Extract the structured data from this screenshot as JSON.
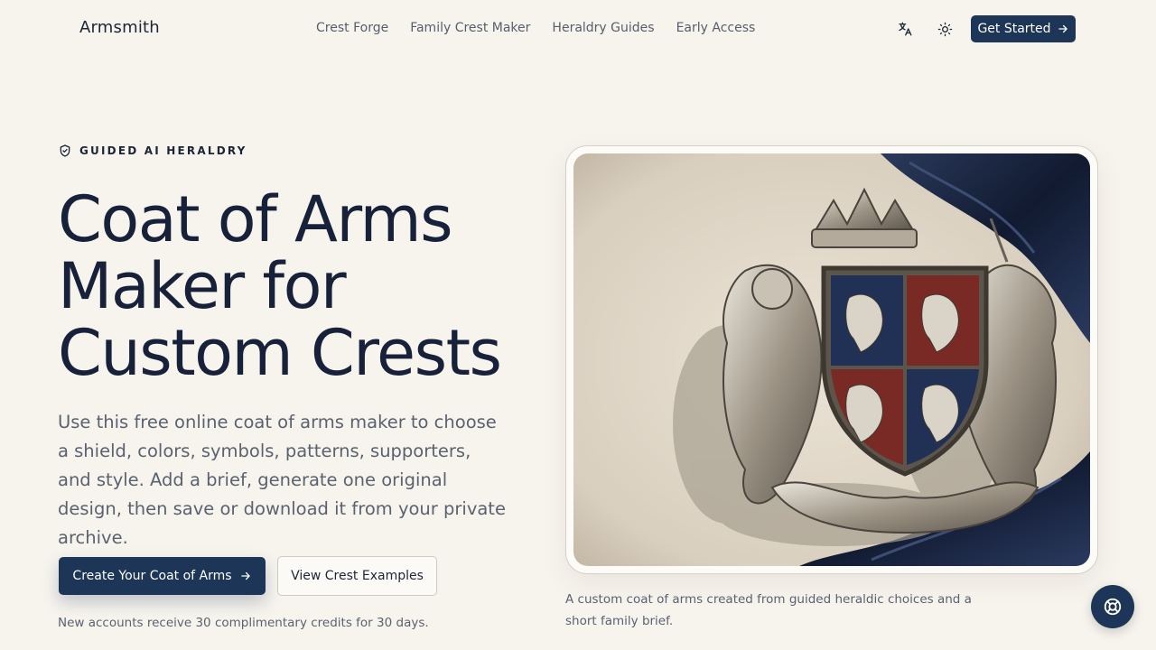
{
  "header": {
    "logo": "Armsmith",
    "nav": [
      "Crest Forge",
      "Family Crest Maker",
      "Heraldry Guides",
      "Early Access"
    ],
    "cta": "Get Started",
    "icons": {
      "translate": "translate-icon",
      "theme": "sun-icon"
    }
  },
  "hero": {
    "eyebrow": "GUIDED AI HERALDRY",
    "title_line1": "Coat of Arms",
    "title_line2": "Maker for",
    "title_line3": "Custom Crests",
    "description": "Use this free online coat of arms maker to choose a shield, colors, symbols, patterns, supporters, and style. Add a brief, generate one original design, then save or download it from your private archive.",
    "primary_cta": "Create Your Coat of Arms",
    "secondary_cta": "View Crest Examples",
    "credits_note": "New accounts receive 30 complimentary credits for 30 days."
  },
  "showcase": {
    "caption": "A custom coat of arms created from guided heraldic choices and a short family brief."
  },
  "colors": {
    "background": "#f7f4ee",
    "primary": "#1d3557",
    "text": "#17213a",
    "muted": "#5a6270"
  }
}
